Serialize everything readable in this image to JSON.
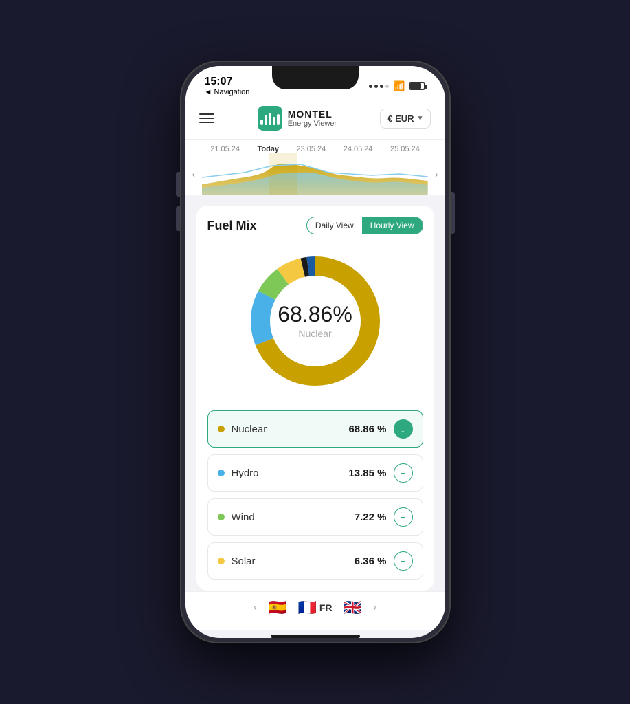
{
  "status": {
    "time": "15:07",
    "nav": "◄ Navigation"
  },
  "header": {
    "logo_name": "MONTEL",
    "logo_subtitle": "Energy Viewer",
    "currency": "€ EUR"
  },
  "timeline": {
    "dates": [
      "21.05.24",
      "Today",
      "23.05.24",
      "24.05.24",
      "25.05.24"
    ],
    "left_arrow": "‹",
    "right_arrow": "›"
  },
  "fuel_mix": {
    "title": "Fuel Mix",
    "view_buttons": [
      {
        "label": "Daily View",
        "active": false
      },
      {
        "label": "Hourly View",
        "active": true
      }
    ],
    "donut": {
      "percent": "68.86%",
      "center_label": "Nuclear"
    },
    "items": [
      {
        "name": "Nuclear",
        "percent": "68.86 %",
        "color": "#c8a000",
        "active": true,
        "icon": "down"
      },
      {
        "name": "Hydro",
        "percent": "13.85 %",
        "color": "#4ab0e8",
        "active": false,
        "icon": "plus"
      },
      {
        "name": "Wind",
        "percent": "7.22 %",
        "color": "#7dc857",
        "active": false,
        "icon": "plus"
      },
      {
        "name": "Solar",
        "percent": "6.36 %",
        "color": "#f5c842",
        "active": false,
        "icon": "plus"
      }
    ]
  },
  "bottom_nav": {
    "left_arrow": "‹",
    "right_arrow": "›",
    "flags": [
      {
        "emoji": "🇪🇸",
        "label": ""
      },
      {
        "emoji": "🇫🇷",
        "label": "FR"
      },
      {
        "emoji": "🇬🇧",
        "label": ""
      }
    ]
  },
  "donut_segments": [
    {
      "color": "#c8a000",
      "percent": 68.86
    },
    {
      "color": "#4ab0e8",
      "percent": 13.85
    },
    {
      "color": "#7dc857",
      "percent": 7.22
    },
    {
      "color": "#f5c842",
      "percent": 6.36
    },
    {
      "color": "#333333",
      "percent": 1.5
    },
    {
      "color": "#1a5aa0",
      "percent": 2.21
    }
  ]
}
